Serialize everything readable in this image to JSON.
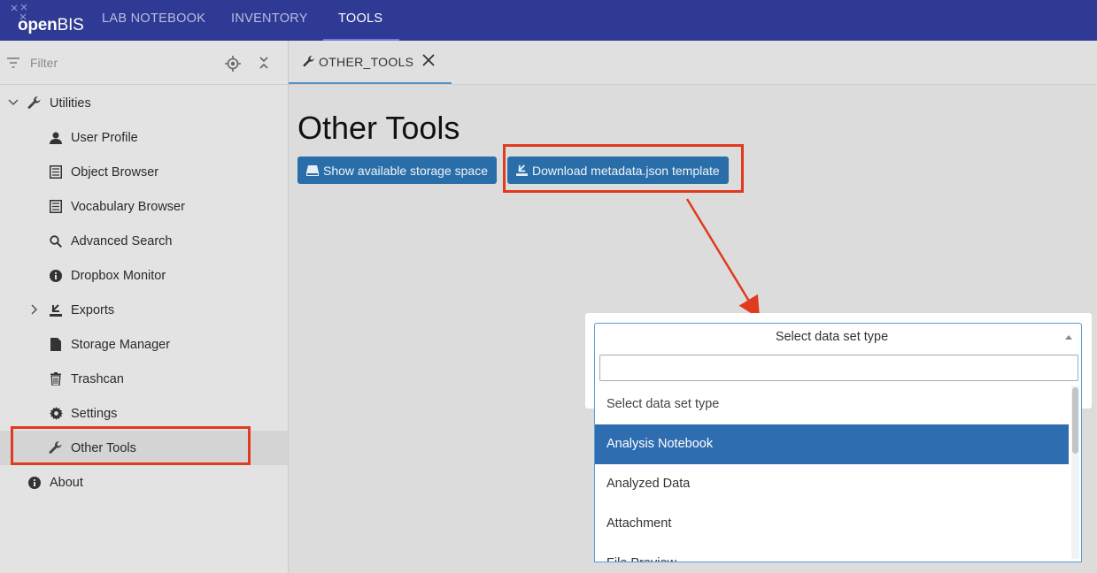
{
  "app": {
    "logo_text_bold": "open",
    "logo_text_rest": "BIS",
    "nav": [
      "LAB NOTEBOOK",
      "INVENTORY",
      "TOOLS"
    ]
  },
  "sidebar": {
    "filter_placeholder": "Filter",
    "items": [
      {
        "label": "Utilities",
        "icon": "wrench-icon"
      },
      {
        "label": "User Profile",
        "icon": "user-icon"
      },
      {
        "label": "Object Browser",
        "icon": "list-icon"
      },
      {
        "label": "Vocabulary Browser",
        "icon": "list-icon"
      },
      {
        "label": "Advanced Search",
        "icon": "search-icon"
      },
      {
        "label": "Dropbox Monitor",
        "icon": "info-icon"
      },
      {
        "label": "Exports",
        "icon": "export-icon"
      },
      {
        "label": "Storage Manager",
        "icon": "file-icon"
      },
      {
        "label": "Trashcan",
        "icon": "trash-icon"
      },
      {
        "label": "Settings",
        "icon": "gear-icon"
      },
      {
        "label": "Other Tools",
        "icon": "wrench-icon"
      },
      {
        "label": "About",
        "icon": "info-icon"
      }
    ]
  },
  "main": {
    "tab_label": "OTHER_TOOLS",
    "title": "Other Tools",
    "buttons": {
      "storage": "Show available storage space",
      "download": "Download metadata.json template"
    }
  },
  "dialog": {
    "select_value": "Select data set type",
    "search_value": "",
    "options": [
      "Select data set type",
      "Analysis Notebook",
      "Analyzed Data",
      "Attachment",
      "File Preview"
    ],
    "highlighted": "Analysis Notebook"
  },
  "colors": {
    "topbar": "#2f3a94",
    "button": "#2a6ea9",
    "highlight": "#e03a1f",
    "selected_option": "#2f6db1"
  }
}
